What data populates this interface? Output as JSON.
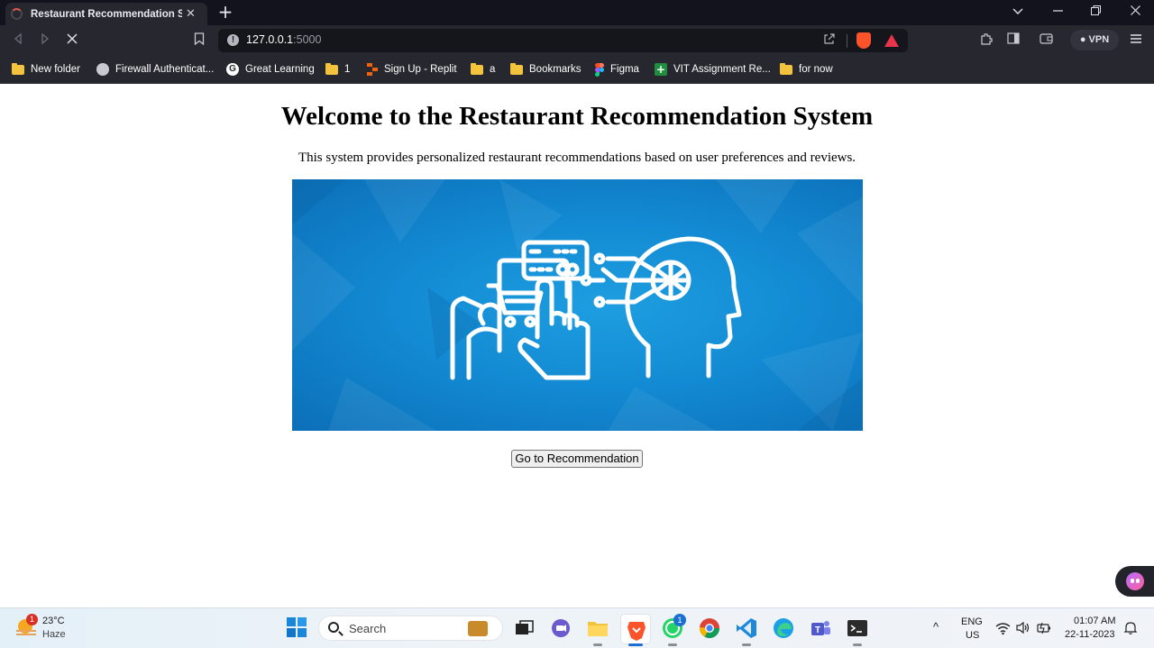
{
  "browser": {
    "tab": {
      "title": "Restaurant Recommendation System"
    },
    "omnibox": {
      "host": "127.0.0.1",
      "port": ":5000"
    },
    "vpn_label": "VPN",
    "bookmarks": [
      {
        "label": "New folder",
        "icon": "folder-icon"
      },
      {
        "label": "Firewall Authenticat...",
        "icon": "globe-icon"
      },
      {
        "label": "Great Learning",
        "icon": "google-icon"
      },
      {
        "label": "1",
        "icon": "folder-icon"
      },
      {
        "label": "Sign Up - Replit",
        "icon": "replit-icon"
      },
      {
        "label": "a",
        "icon": "folder-icon"
      },
      {
        "label": "Bookmarks",
        "icon": "folder-icon"
      },
      {
        "label": "Figma",
        "icon": "figma-icon"
      },
      {
        "label": "VIT Assignment Re...",
        "icon": "vit-icon"
      },
      {
        "label": "for now",
        "icon": "folder-icon"
      }
    ]
  },
  "page": {
    "title": "Welcome to the Restaurant Recommendation System",
    "description": "This system provides personalized restaurant recommendations based on user preferences and reviews.",
    "hero_image": "ai-shopping-illustration",
    "button_label": "Go to Recommendation"
  },
  "taskbar": {
    "weather": {
      "temp": "23°C",
      "condition": "Haze",
      "badge": "1"
    },
    "search_label": "Search",
    "whatsapp_badge": "1",
    "language": {
      "line1": "ENG",
      "line2": "US"
    },
    "clock": {
      "time": "01:07 AM",
      "date": "22-11-2023"
    }
  },
  "colors": {
    "hero_blue": "#138bd4",
    "brave_orange": "#fb542b",
    "folder_yellow": "#f4c33d"
  }
}
